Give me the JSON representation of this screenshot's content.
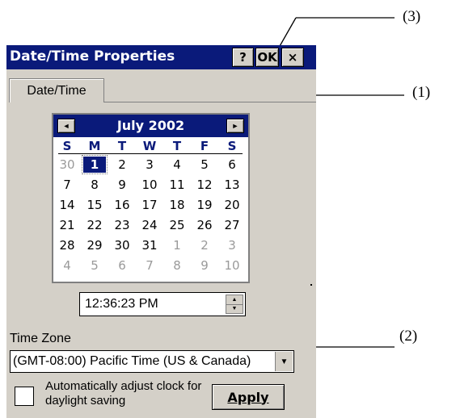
{
  "callouts": {
    "c3": "(3)",
    "c1": "(1)",
    "c2": "(2)"
  },
  "window": {
    "title": "Date/Time Properties",
    "help_label": "?",
    "ok_label": "OK",
    "close_label": "×"
  },
  "tabs": [
    {
      "label": "Date/Time"
    }
  ],
  "calendar": {
    "month_label": "July 2002",
    "prev_icon": "◄",
    "next_icon": "►",
    "weekdays": [
      "S",
      "M",
      "T",
      "W",
      "T",
      "F",
      "S"
    ],
    "weeks": [
      [
        "30",
        "1",
        "2",
        "3",
        "4",
        "5",
        "6"
      ],
      [
        "7",
        "8",
        "9",
        "10",
        "11",
        "12",
        "13"
      ],
      [
        "14",
        "15",
        "16",
        "17",
        "18",
        "19",
        "20"
      ],
      [
        "21",
        "22",
        "23",
        "24",
        "25",
        "26",
        "27"
      ],
      [
        "28",
        "29",
        "30",
        "31",
        "1",
        "2",
        "3"
      ],
      [
        "4",
        "5",
        "6",
        "7",
        "8",
        "9",
        "10"
      ]
    ],
    "selected_day": "1"
  },
  "time": {
    "value": "12:36:23 PM",
    "up_icon": "▲",
    "down_icon": "▼"
  },
  "time_zone": {
    "label": "Time Zone",
    "value": "(GMT-08:00) Pacific Time (US & Canada)",
    "arrow_icon": "▼"
  },
  "dst": {
    "label": "Automatically adjust clock for daylight saving",
    "checked": false
  },
  "apply_label": "Apply",
  "colors": {
    "title_bar": "#0a1a7a",
    "dialog_bg": "#d4d0c8"
  }
}
